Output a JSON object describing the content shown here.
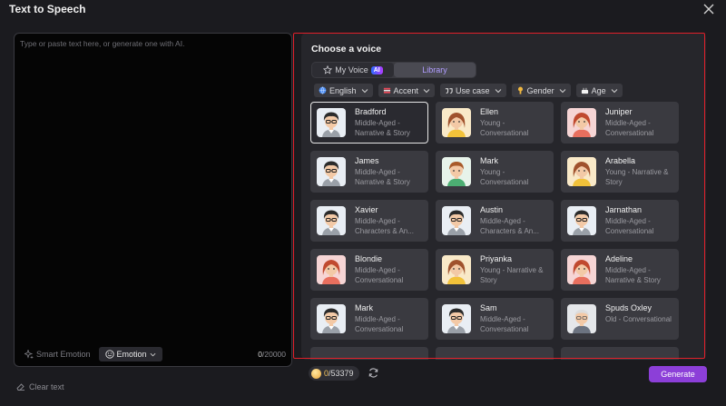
{
  "window": {
    "title": "Text to Speech"
  },
  "editor": {
    "placeholder": "Type or paste text here, or generate one with AI.",
    "smart_emotion_label": "Smart Emotion",
    "emotion_label": "Emotion",
    "char_current": "0",
    "char_max": "/20000",
    "clear_label": "Clear text"
  },
  "voices": {
    "heading": "Choose a voice",
    "tabs": [
      {
        "label": "My Voice",
        "badge": "AI",
        "active": false
      },
      {
        "label": "Library",
        "active": true
      }
    ],
    "filters": [
      {
        "label": "English",
        "icon": "globe-icon"
      },
      {
        "label": "Accent",
        "icon": "accent-icon"
      },
      {
        "label": "Use case",
        "icon": "quote-icon"
      },
      {
        "label": "Gender",
        "icon": "gender-icon"
      },
      {
        "label": "Age",
        "icon": "age-icon"
      }
    ],
    "cards": [
      {
        "name": "Bradford",
        "desc": "Middle-Aged - Narrative & Story",
        "avatar": "man-dark",
        "selected": true
      },
      {
        "name": "Ellen",
        "desc": "Young - Conversational",
        "avatar": "woman-yellow"
      },
      {
        "name": "Juniper",
        "desc": "Middle-Aged - Conversational",
        "avatar": "woman-red"
      },
      {
        "name": "James",
        "desc": "Middle-Aged - Narrative & Story",
        "avatar": "man-dark"
      },
      {
        "name": "Mark",
        "desc": "Young - Conversational",
        "avatar": "man-green"
      },
      {
        "name": "Arabella",
        "desc": "Young - Narrative & Story",
        "avatar": "woman-yellow"
      },
      {
        "name": "Xavier",
        "desc": "Middle-Aged - Characters & An...",
        "avatar": "man-dark"
      },
      {
        "name": "Austin",
        "desc": "Middle-Aged - Characters & An...",
        "avatar": "man-dark"
      },
      {
        "name": "Jarnathan",
        "desc": "Middle-Aged - Conversational",
        "avatar": "man-dark"
      },
      {
        "name": "Blondie",
        "desc": "Middle-Aged - Conversational",
        "avatar": "woman-red"
      },
      {
        "name": "Priyanka",
        "desc": "Young - Narrative & Story",
        "avatar": "woman-yellow"
      },
      {
        "name": "Adeline",
        "desc": "Middle-Aged - Narrative & Story",
        "avatar": "woman-red"
      },
      {
        "name": "Mark",
        "desc": "Middle-Aged - Conversational",
        "avatar": "man-dark"
      },
      {
        "name": "Sam",
        "desc": "Middle-Aged - Conversational",
        "avatar": "man-dark"
      },
      {
        "name": "Spuds Oxley",
        "desc": "Old - Conversational",
        "avatar": "old-man"
      },
      {
        "name": "",
        "desc": "",
        "avatar": ""
      },
      {
        "name": "",
        "desc": "",
        "avatar": ""
      },
      {
        "name": "",
        "desc": "",
        "avatar": ""
      }
    ]
  },
  "footer": {
    "credits_current": "0",
    "credits_total": "/53379",
    "generate_label": "Generate"
  },
  "colors": {
    "accent": "#8c3fd8",
    "highlight_frame": "#e0202a",
    "library_tab_text": "#b09cff"
  }
}
